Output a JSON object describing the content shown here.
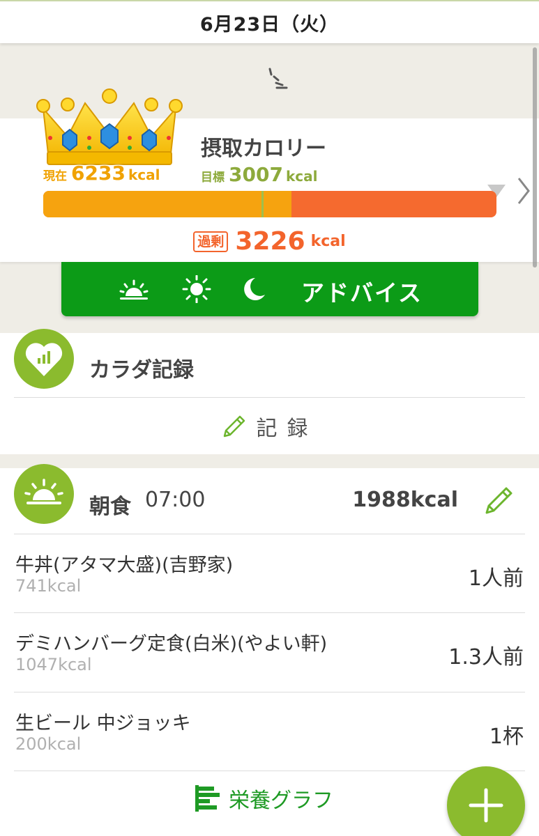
{
  "header": {
    "date": "6月23日（火）"
  },
  "calorie_card": {
    "title": "摂取カロリー",
    "current_label": "現在",
    "current_value": "6233",
    "target_label": "目標",
    "target_value": "3007",
    "unit": "kcal",
    "excess_label": "過剰",
    "excess_value": "3226",
    "bar_orange_fraction": 0.548,
    "bar_target_tick_fraction": 0.482
  },
  "advice_button": {
    "label": "アドバイス",
    "icons": [
      "sunrise-icon",
      "sun-icon",
      "moon-icon"
    ]
  },
  "body_record": {
    "title": "カラダ記録",
    "action_label": "記録",
    "icon": "heart-chart-icon"
  },
  "meal": {
    "title": "朝食",
    "time": "07:00",
    "total_kcal": "1988kcal",
    "icon": "sunrise-icon",
    "items": [
      {
        "name": "牛丼(アタマ大盛)(吉野家)",
        "kcal": "741kcal",
        "qty": "1人前"
      },
      {
        "name": "デミハンバーグ定食(白米)(やよい軒)",
        "kcal": "1047kcal",
        "qty": "1.3人前"
      },
      {
        "name": "生ビール 中ジョッキ",
        "kcal": "200kcal",
        "qty": "1杯"
      }
    ],
    "graph_label": "栄養グラフ"
  },
  "colors": {
    "green_accent": "#8bbb2e",
    "advice_green": "#0c9b17",
    "current_orange": "#f0a202",
    "excess_orange": "#f3642c",
    "target_green": "#8daa3c"
  }
}
